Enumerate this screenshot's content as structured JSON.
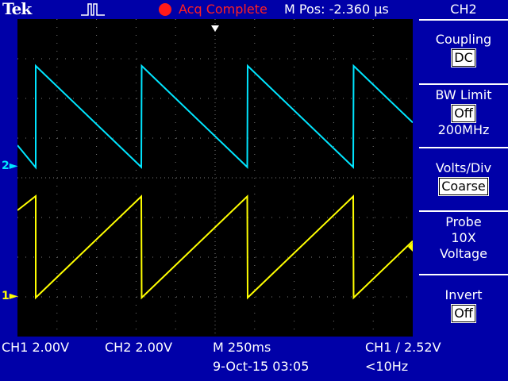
{
  "header": {
    "brand": "Tek",
    "acq_status": "Acq Complete",
    "m_pos": "M Pos: -2.360 µs"
  },
  "side_menu": {
    "title": "CH2",
    "coupling": {
      "label": "Coupling",
      "value": "DC"
    },
    "bw_limit": {
      "label": "BW Limit",
      "value": "Off",
      "sub": "200MHz"
    },
    "volts_div": {
      "label": "Volts/Div",
      "value": "Coarse"
    },
    "probe": {
      "label": "Probe",
      "line2": "10X",
      "line3": "Voltage"
    },
    "invert": {
      "label": "Invert",
      "value": "Off"
    }
  },
  "markers": {
    "ch1": "1",
    "ch2": "2"
  },
  "footer": {
    "ch1_scale": "CH1  2.00V",
    "ch2_scale": "CH2  2.00V",
    "timebase": "M 250ms",
    "date": "9-Oct-15 03:05",
    "trigger": "CH1 ∕ 2.52V",
    "freq": "<10Hz"
  },
  "colors": {
    "ch1": "#ffff00",
    "ch2": "#00e5ff",
    "accent": "#ff1a1a",
    "panel": "#0000a8"
  },
  "chart_data": {
    "type": "line",
    "period": 3.3,
    "series": [
      {
        "name": "CH2",
        "shape": "sawtooth-falling",
        "high_div": 3.2,
        "low_div": 0.0,
        "offset_div": 0.0
      },
      {
        "name": "CH1",
        "shape": "sawtooth-rising",
        "high_div": 3.2,
        "low_div": 0.0,
        "offset_div": 0.0
      }
    ]
  }
}
